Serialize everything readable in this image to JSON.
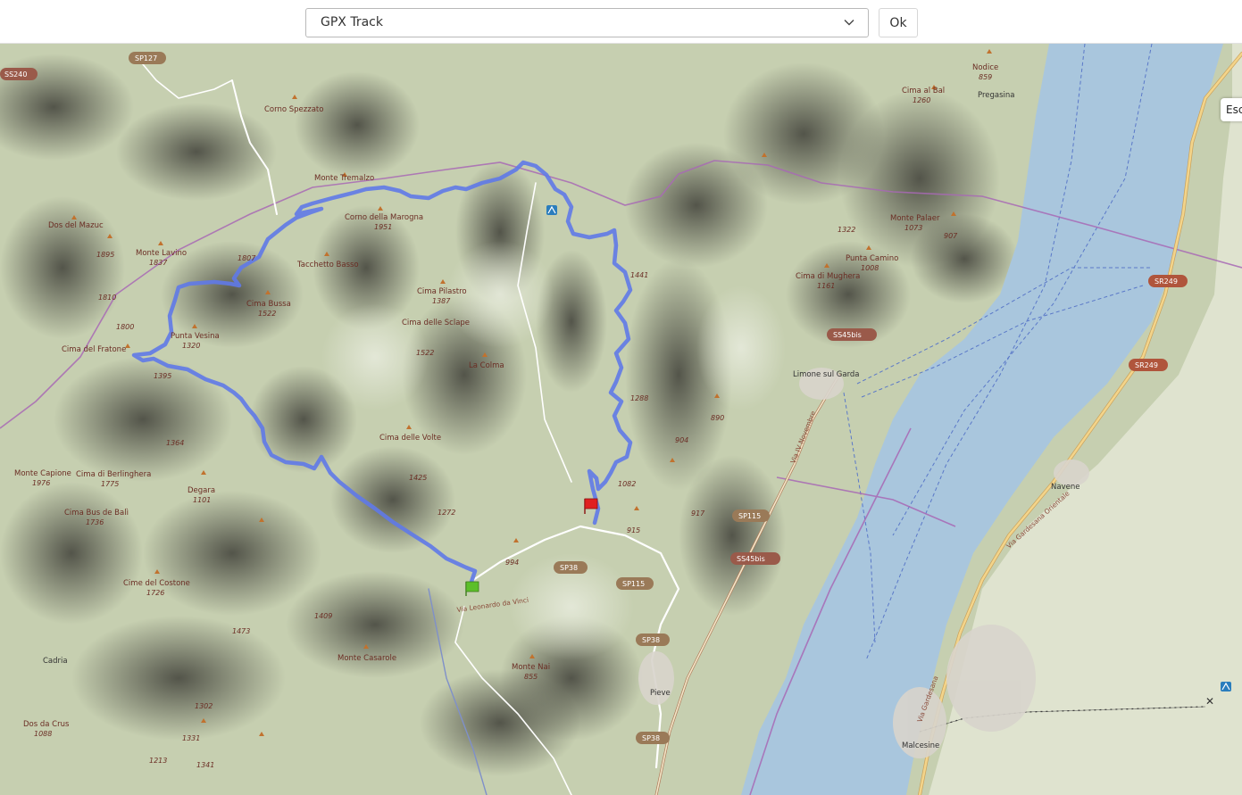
{
  "toolbar": {
    "track_select": {
      "selected": "GPX Track"
    },
    "ok_label": "Ok"
  },
  "map": {
    "esc_label": "Esc",
    "peaks": [
      {
        "name": "Corno Spezzato",
        "ele": ""
      },
      {
        "name": "Monte Tremalzo",
        "ele": ""
      },
      {
        "name": "Corno della Marogna",
        "ele": "1951"
      },
      {
        "name": "Dos del Mazuc",
        "ele": ""
      },
      {
        "name": "Monte Lavino",
        "ele": "1837"
      },
      {
        "name": "Tacchetto Basso",
        "ele": ""
      },
      {
        "name": "Cima Bussa",
        "ele": "1522"
      },
      {
        "name": "Cima Pilastro",
        "ele": "1387"
      },
      {
        "name": "Cima delle Sclape",
        "ele": ""
      },
      {
        "name": "Punta Vesina",
        "ele": "1320"
      },
      {
        "name": "Cima del Fratone",
        "ele": ""
      },
      {
        "name": "La Colma",
        "ele": ""
      },
      {
        "name": "Cima delle Volte",
        "ele": ""
      },
      {
        "name": "Monte Capione",
        "ele": "1976"
      },
      {
        "name": "Cima di Berlinghera",
        "ele": "1775"
      },
      {
        "name": "Degara",
        "ele": "1101"
      },
      {
        "name": "Cima Bus de Balì",
        "ele": "1736"
      },
      {
        "name": "Cime del Costone",
        "ele": "1726"
      },
      {
        "name": "Monte Casarole",
        "ele": ""
      },
      {
        "name": "Monte Nai",
        "ele": "855"
      },
      {
        "name": "Dos da Crus",
        "ele": "1088"
      },
      {
        "name": "Cima al Bal",
        "ele": "1260"
      },
      {
        "name": "Nodice",
        "ele": "859"
      },
      {
        "name": "Monte Palaer",
        "ele": "1073"
      },
      {
        "name": "Punta Camino",
        "ele": "1008"
      },
      {
        "name": "Cima di Mughera",
        "ele": "1161"
      }
    ],
    "spot_heights": [
      "1895",
      "1807",
      "1810",
      "1800",
      "1395",
      "1364",
      "1522",
      "1425",
      "1272",
      "994",
      "1409",
      "1473",
      "1302",
      "1331",
      "1341",
      "1213",
      "1441",
      "1288",
      "1082",
      "915",
      "904",
      "890",
      "917",
      "1322",
      "907"
    ],
    "towns": [
      "Pregasina",
      "Limone sul Garda",
      "Navene",
      "Malcesine",
      "Cadria",
      "Pieve"
    ],
    "roads": {
      "shields": [
        "SS240",
        "SP127",
        "SS45bis",
        "SR249",
        "SR249",
        "SP115",
        "SS45bis",
        "SP38",
        "SP115",
        "SP38",
        "SP38"
      ],
      "names": [
        "Via Leonardo da Vinci",
        "Via IV Novembre",
        "Via Gardesana Orientale",
        "Via Gardesana"
      ]
    },
    "colors": {
      "track": "#5f79e8",
      "lake": "#a9c6dd",
      "terrain": "#c8d2b3",
      "shade": "#4d4d44",
      "road_primary": "#f3d48a",
      "boundary": "#9b59b6",
      "start_flag": "#5cbf2a",
      "finish_flag": "#e02020"
    },
    "icons": [
      "start-flag-icon",
      "finish-flag-icon",
      "shelter-icon",
      "lift-pylon-icon",
      "peak-icon"
    ]
  }
}
